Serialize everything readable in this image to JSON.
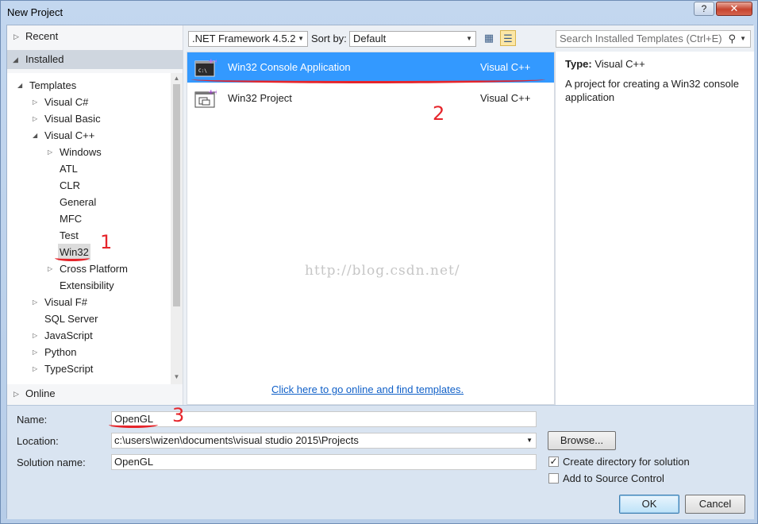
{
  "window": {
    "title": "New Project",
    "help": "?",
    "close": "✕"
  },
  "left_pane": {
    "recent": "Recent",
    "installed": "Installed",
    "online": "Online",
    "tree": [
      {
        "label": "Templates",
        "expander": "expanded"
      },
      {
        "label": "Visual C#",
        "expander": "collapsed"
      },
      {
        "label": "Visual Basic",
        "expander": "collapsed"
      },
      {
        "label": "Visual C++",
        "expander": "expanded"
      },
      {
        "label": "Windows",
        "expander": "collapsed"
      },
      {
        "label": "ATL",
        "expander": "none"
      },
      {
        "label": "CLR",
        "expander": "none"
      },
      {
        "label": "General",
        "expander": "none"
      },
      {
        "label": "MFC",
        "expander": "none"
      },
      {
        "label": "Test",
        "expander": "none"
      },
      {
        "label": "Win32",
        "expander": "none",
        "selected": true
      },
      {
        "label": "Cross Platform",
        "expander": "collapsed"
      },
      {
        "label": "Extensibility",
        "expander": "none"
      },
      {
        "label": "Visual F#",
        "expander": "collapsed"
      },
      {
        "label": "SQL Server",
        "expander": "none"
      },
      {
        "label": "JavaScript",
        "expander": "collapsed"
      },
      {
        "label": "Python",
        "expander": "collapsed"
      },
      {
        "label": "TypeScript",
        "expander": "collapsed"
      }
    ]
  },
  "toolbar": {
    "framework": ".NET Framework 4.5.2",
    "sort_label": "Sort by:",
    "sort_value": "Default",
    "search_placeholder": "Search Installed Templates (Ctrl+E)"
  },
  "templates": [
    {
      "name": "Win32 Console Application",
      "language": "Visual C++",
      "selected": true,
      "icon": "console-app-icon"
    },
    {
      "name": "Win32 Project",
      "language": "Visual C++",
      "selected": false,
      "icon": "win32-project-icon"
    }
  ],
  "online_link": "Click here to go online and find templates.",
  "description": {
    "type_label": "Type:",
    "type_value": "Visual C++",
    "text": "A project for creating a Win32 console application"
  },
  "form": {
    "name_label": "Name:",
    "name_value": "OpenGL",
    "location_label": "Location:",
    "location_value": "c:\\users\\wizen\\documents\\visual studio 2015\\Projects",
    "solution_label": "Solution name:",
    "solution_value": "OpenGL",
    "browse": "Browse...",
    "create_dir": "Create directory for solution",
    "create_dir_checked": true,
    "source_control": "Add to Source Control",
    "source_control_checked": false,
    "ok": "OK",
    "cancel": "Cancel"
  },
  "annotations": {
    "a1": "1",
    "a2": "2",
    "a3": "3"
  },
  "watermark": "http://blog.csdn.net/",
  "colors": {
    "selection": "#3399ff",
    "annotation": "#e6252b",
    "link": "#1060c8"
  }
}
